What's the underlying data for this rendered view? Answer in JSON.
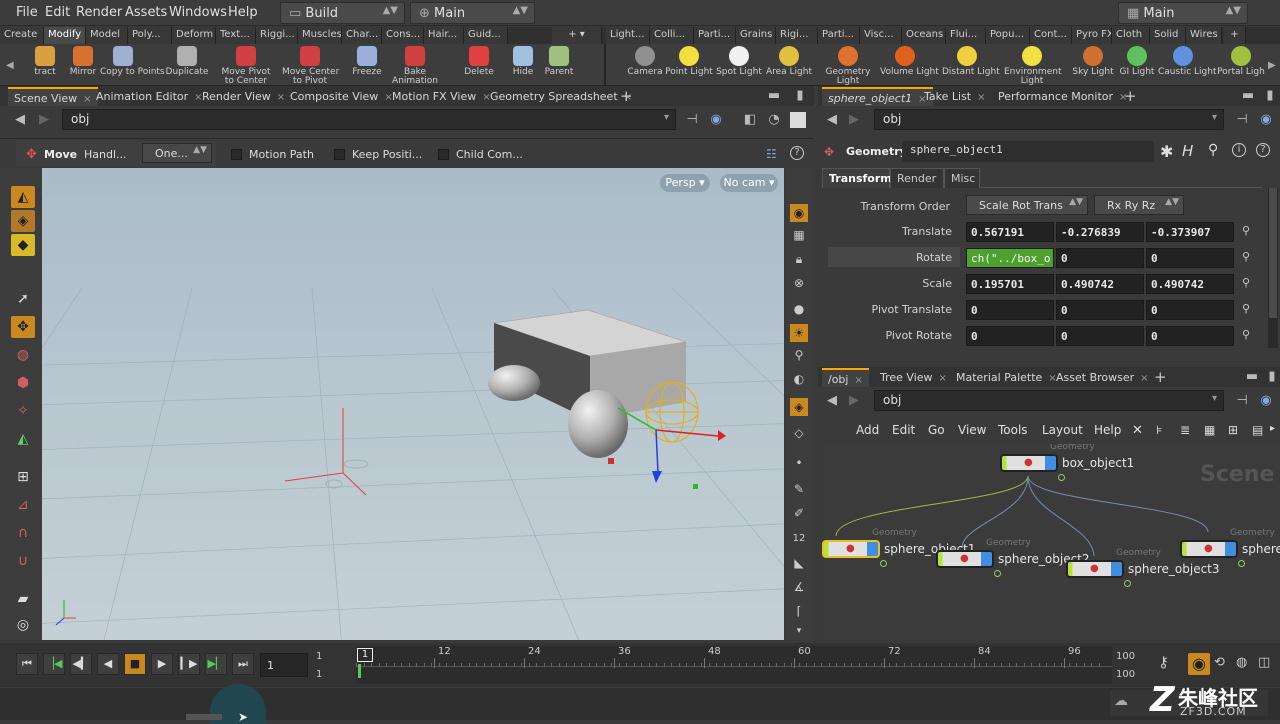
{
  "menubar": {
    "items": [
      "File",
      "Edit",
      "Render",
      "Assets",
      "Windows",
      "Help"
    ],
    "desktop": "Build",
    "context": "Main",
    "right_context": "Main"
  },
  "shelf": {
    "left_tabs": [
      "Create",
      "Modify",
      "Model",
      "Poly...",
      "Deform",
      "Text...",
      "Riggi...",
      "Muscles",
      "Char...",
      "Cons...",
      "Hair...",
      "Guid..."
    ],
    "right_tabs": [
      "Light...",
      "Colli...",
      "Parti...",
      "Grains",
      "Rigi...",
      "Parti...",
      "Visc...",
      "Oceans",
      "Flui...",
      "Popu...",
      "Cont...",
      "Pyro FX",
      "Cloth",
      "Solid",
      "Wires"
    ],
    "left_tools": [
      "tract",
      "Mirror",
      "Copy to Points",
      "Duplicate",
      "Move Pivot\nto Center",
      "Move Center\nto Pivot",
      "Freeze",
      "Bake\nAnimation",
      "Delete",
      "Hide",
      "Parent"
    ],
    "right_tools": [
      "Camera",
      "Point Light",
      "Spot Light",
      "Area Light",
      "Geometry\nLight",
      "Volume Light",
      "Distant Light",
      "Environment\nLight",
      "Sky Light",
      "GI Light",
      "Caustic Light",
      "Portal Ligh"
    ]
  },
  "left_pane": {
    "tabs": [
      "Scene View",
      "Animation Editor",
      "Render View",
      "Composite View",
      "Motion FX View",
      "Geometry Spreadsheet"
    ],
    "path": "obj",
    "operation": "Move",
    "handle": "Handl...",
    "one": "One...",
    "checks": [
      "Motion Path",
      "Keep Positi...",
      "Child Com..."
    ],
    "persp": "Persp",
    "cam": "No cam"
  },
  "right_top": {
    "tabs": [
      "sphere_object1",
      "Take List",
      "Performance Monitor"
    ],
    "path": "obj",
    "node_type": "Geometry",
    "node_name": "sphere_object1",
    "param_tabs": [
      "Transform",
      "Render",
      "Misc"
    ],
    "transform_order_label": "Transform Order",
    "transform_order": "Scale Rot Trans",
    "rot_order": "Rx Ry Rz",
    "rows": [
      {
        "label": "Translate",
        "values": [
          "0.567191",
          "-0.276839",
          "-0.373907"
        ]
      },
      {
        "label": "Rotate",
        "values": [
          "ch(\"../box_o",
          "0",
          "0"
        ]
      },
      {
        "label": "Scale",
        "values": [
          "0.195701",
          "0.490742",
          "0.490742"
        ]
      },
      {
        "label": "Pivot Translate",
        "values": [
          "0",
          "0",
          "0"
        ]
      },
      {
        "label": "Pivot Rotate",
        "values": [
          "0",
          "0",
          "0"
        ]
      }
    ]
  },
  "right_bottom": {
    "tabs": [
      "/obj",
      "Tree View",
      "Material Palette",
      "Asset Browser"
    ],
    "path": "obj",
    "menu": [
      "Add",
      "Edit",
      "Go",
      "View",
      "Tools",
      "Layout",
      "Help"
    ],
    "watermark": "Scene",
    "nodes": [
      {
        "type": "Geometry",
        "name": "box_object1"
      },
      {
        "type": "Geometry",
        "name": "sphere_object1"
      },
      {
        "type": "Geometry",
        "name": "sphere_object2"
      },
      {
        "type": "Geometry",
        "name": "sphere_object3"
      },
      {
        "type": "Geometry",
        "name": "sphere"
      }
    ]
  },
  "timeline": {
    "current_frame": "1",
    "start": "1",
    "start2": "1",
    "ticks": [
      "1",
      "12",
      "24",
      "36",
      "48",
      "60",
      "72",
      "84",
      "96"
    ],
    "end": "100",
    "end2": "100"
  },
  "watermark": {
    "brand": "朱峰社区",
    "site": "ZF3D.COM"
  }
}
